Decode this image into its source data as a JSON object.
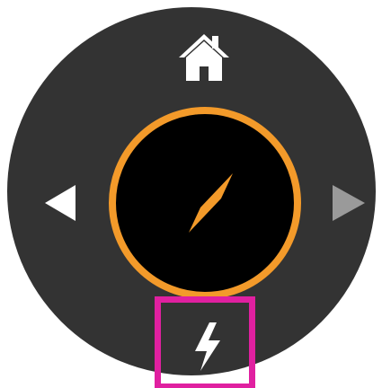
{
  "dial": {
    "background_color": "#333333"
  },
  "home_button": {
    "icon": "home-icon",
    "color": "#ffffff"
  },
  "nav": {
    "left_arrow": {
      "icon": "triangle-left-icon",
      "color": "#ffffff"
    },
    "right_arrow": {
      "icon": "triangle-right-icon",
      "color": "#9a9a9a"
    }
  },
  "compass": {
    "ring_color": "#f39a2a",
    "face_color": "#000000",
    "needle_color": "#f39a2a",
    "icon": "compass-needle-icon"
  },
  "flash_button": {
    "icon": "lightning-bolt-icon",
    "icon_color": "#ffffff",
    "highlight_color": "#e020a0",
    "selected": true
  }
}
